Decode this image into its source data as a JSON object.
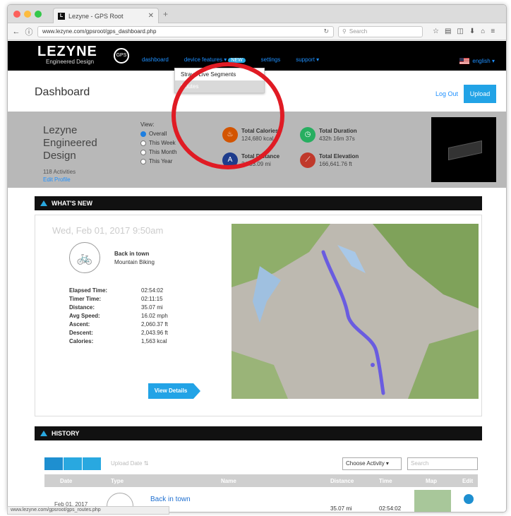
{
  "browser": {
    "tab_title": "Lezyne - GPS Root",
    "tab_favicon": "L",
    "url": "www.lezyne.com/gpsroot/gps_dashboard.php",
    "search_placeholder": "Search"
  },
  "header": {
    "brand": "LEZYNE",
    "tagline": "Engineered Design",
    "badge": "GPS",
    "menu": [
      {
        "label": "dashboard"
      },
      {
        "label": "device features ▾",
        "badge": "NEW"
      },
      {
        "label": "settings"
      },
      {
        "label": "support ▾"
      }
    ],
    "language": "english ▾"
  },
  "dropdown": {
    "items": [
      "Strava Live Segments",
      "Routes"
    ]
  },
  "page": {
    "title": "Dashboard",
    "logout": "Log Out",
    "upload": "Upload"
  },
  "profile": {
    "name": "Lezyne Engineered Design",
    "activities": "118 Activities",
    "link": "Edit Profile",
    "view_label": "View:",
    "view_options": [
      "Overall",
      "This Week",
      "This Month",
      "This Year"
    ],
    "view_selected": "Overall",
    "stats": [
      {
        "label": "Total Calories",
        "value": "124,680 kcal",
        "icon": "flame-icon",
        "color": "#d35400"
      },
      {
        "label": "Total Duration",
        "value": "432h 16m 37s",
        "icon": "clock-icon",
        "color": "#27ae60"
      },
      {
        "label": "Total Distance",
        "value": "2,753.09 mi",
        "icon": "distance-icon",
        "color": "#1e3c8c"
      },
      {
        "label": "Total Elevation",
        "value": "166,641.76 ft",
        "icon": "elevation-icon",
        "color": "#c0392b"
      }
    ]
  },
  "whats_new": {
    "heading": "WHAT'S NEW",
    "date": "Wed, Feb 01, 2017 9:50am",
    "activity_title": "Back in town",
    "activity_type": "Mountain Biking",
    "metrics": [
      {
        "label": "Elapsed Time:",
        "value": "02:54:02"
      },
      {
        "label": "Timer Time:",
        "value": "02:11:15"
      },
      {
        "label": "Distance:",
        "value": "35.07 mi"
      },
      {
        "label": "Avg Speed:",
        "value": "16.02 mph"
      },
      {
        "label": "Ascent:",
        "value": "2,060.37 ft"
      },
      {
        "label": "Descent:",
        "value": "2,043.96 ft"
      },
      {
        "label": "Calories:",
        "value": "1,563 kcal"
      }
    ],
    "view_details": "View Details"
  },
  "history": {
    "heading": "HISTORY",
    "upload_date": "Upload Date ⇅",
    "choose_activity": "Choose Activity ▾",
    "search_placeholder": "Search",
    "columns": [
      "Date",
      "Type",
      "Name",
      "Distance",
      "Time",
      "Map",
      "Edit"
    ],
    "row": {
      "date": "Feb 01, 2017",
      "name": "Back in town",
      "distance": "35.07 mi",
      "time": "02:54:02"
    }
  },
  "status_url": "www.lezyne.com/gpsroot/gps_routes.php"
}
